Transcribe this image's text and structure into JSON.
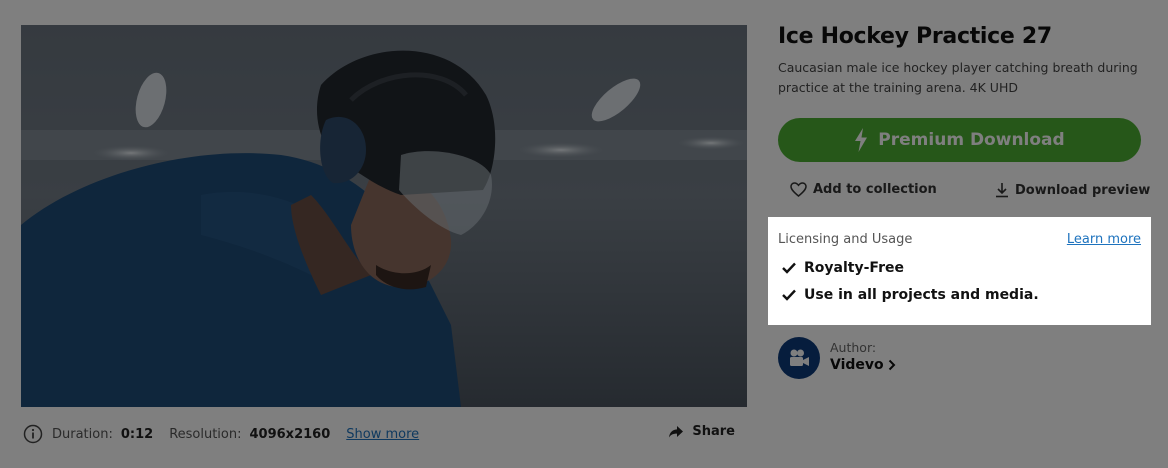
{
  "video": {
    "duration_label": "Duration:",
    "duration_value": "0:12",
    "resolution_label": "Resolution:",
    "resolution_value": "4096x2160",
    "show_more": "Show more",
    "share": "Share"
  },
  "details": {
    "title": "Ice Hockey Practice 27",
    "description": "Caucasian male ice hockey player catching breath during practice at the training arena. 4K UHD",
    "premium_download": "Premium Download",
    "add_to_collection": "Add to collection",
    "download_preview": "Download preview"
  },
  "licensing": {
    "heading": "Licensing and Usage",
    "learn_more": "Learn more",
    "items": [
      "Royalty-Free",
      "Use in all projects and media."
    ]
  },
  "author": {
    "label": "Author:",
    "name": "Videvo"
  },
  "colors": {
    "accent_green": "#4caf32",
    "link_blue": "#1e73be",
    "author_avatar": "#0d3a7a"
  }
}
